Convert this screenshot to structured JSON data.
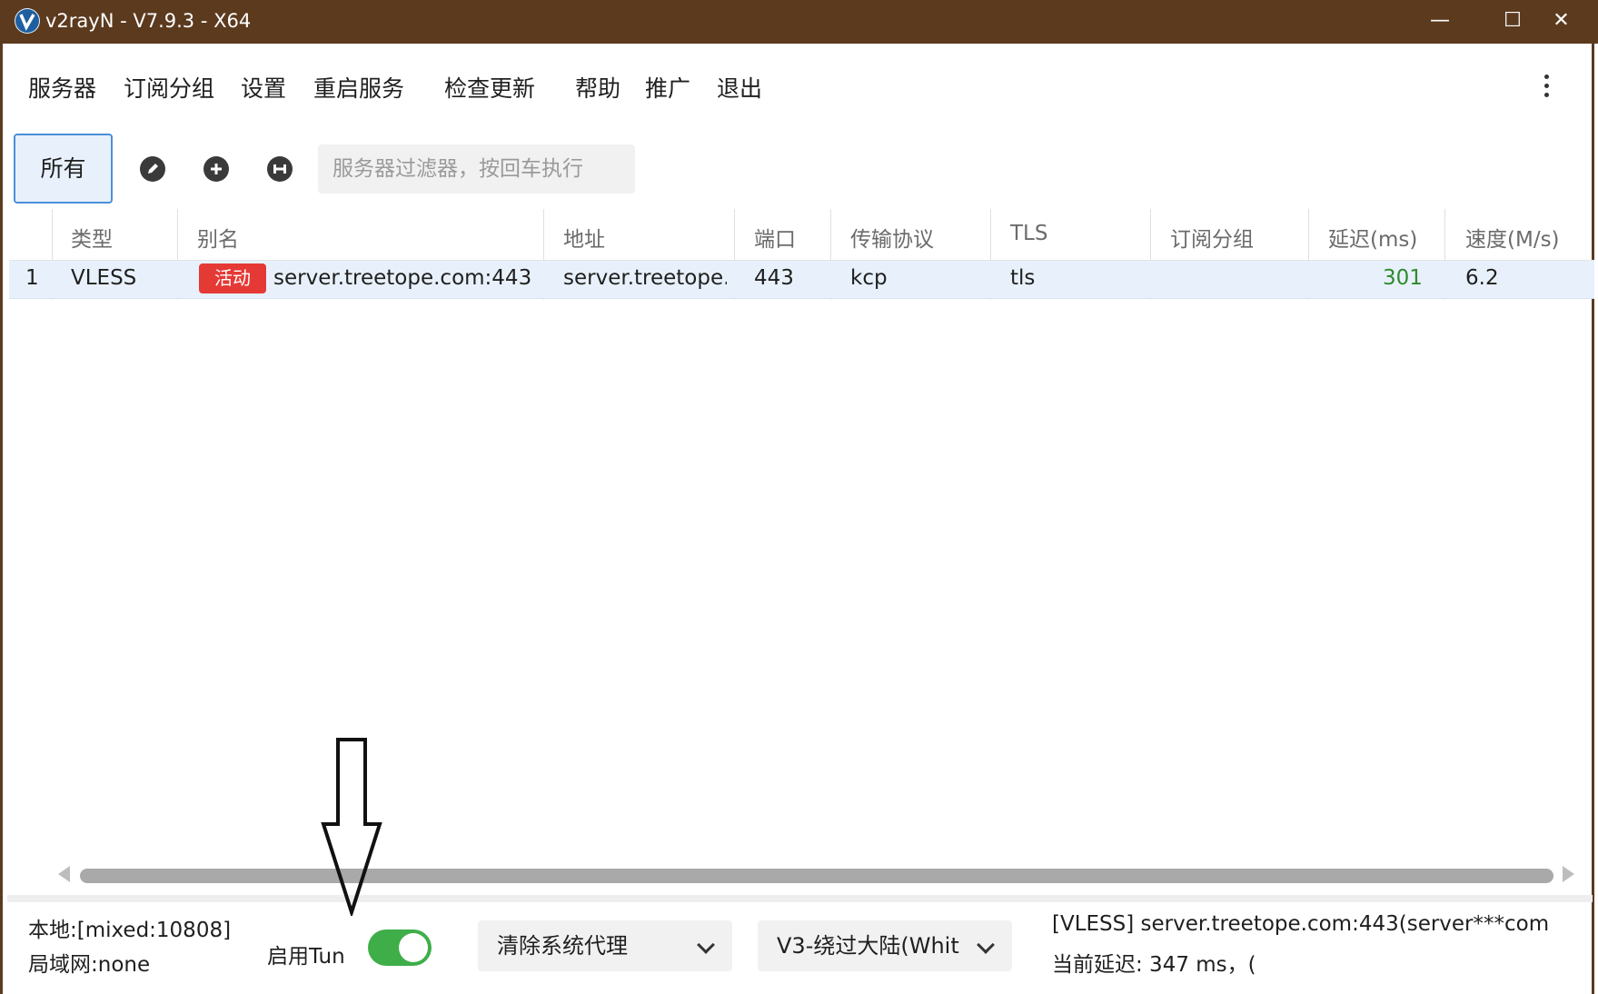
{
  "window": {
    "title": "v2rayN - V7.9.3 - X64",
    "minimize": "—",
    "maximize": "☐",
    "close": "✕"
  },
  "menu": {
    "items": [
      "服务器",
      "订阅分组",
      "设置",
      "重启服务",
      "检查更新",
      "帮助",
      "推广",
      "退出"
    ]
  },
  "toolbar": {
    "all_tab": "所有",
    "filter_placeholder": "服务器过滤器，按回车执行"
  },
  "table": {
    "columns": [
      "类型",
      "别名",
      "地址",
      "端口",
      "传输协议",
      "TLS",
      "订阅分组",
      "延迟(ms)",
      "速度(M/s)"
    ],
    "rows": [
      {
        "index": "1",
        "type": "VLESS",
        "badge": "活动",
        "alias": "server.treetope.com:443",
        "address": "server.treetope.com",
        "port": "443",
        "transport": "kcp",
        "tls": "tls",
        "sub_group": "",
        "delay": "301",
        "speed": "6.2"
      }
    ]
  },
  "status": {
    "local": "本地:[mixed:10808]",
    "lan": "局域网:none",
    "tun_label": "启用Tun",
    "tun_enabled": true,
    "proxy_mode": "清除系统代理",
    "routing": "V3-绕过大陆(Whit",
    "current_server": "[VLESS] server.treetope.com:443(server***com",
    "current_delay": "当前延迟: 347 ms，("
  },
  "colors": {
    "titlebar": "#5c3a1e",
    "accent": "#4a90d9",
    "badge": "#e53935",
    "toggle_on": "#3fae49",
    "delay_ok": "#2e8b2e"
  }
}
